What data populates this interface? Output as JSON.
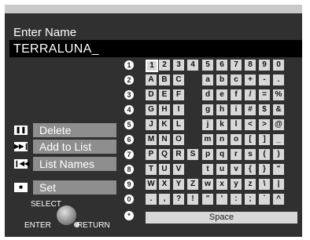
{
  "title": "Enter Name",
  "name_value": "TERRALUNA_",
  "row_numbers": [
    "1",
    "2",
    "3",
    "4",
    "5",
    "6",
    "7",
    "8",
    "9",
    "0",
    "*"
  ],
  "keys": [
    [
      "1",
      "2",
      "3",
      "4",
      "5",
      "6",
      "7",
      "8",
      "9",
      "0"
    ],
    [
      "A",
      "B",
      "C",
      "",
      "a",
      "b",
      "c",
      "+",
      "-",
      "."
    ],
    [
      "D",
      "E",
      "F",
      "",
      "d",
      "e",
      "f",
      "/",
      "=",
      "%"
    ],
    [
      "G",
      "H",
      "I",
      "",
      "g",
      "h",
      "i",
      "#",
      "$",
      "&"
    ],
    [
      "J",
      "K",
      "L",
      "",
      "j",
      "k",
      "l",
      "<",
      ">",
      "@"
    ],
    [
      "M",
      "N",
      "O",
      "",
      "m",
      "n",
      "o",
      "[",
      "]",
      "_"
    ],
    [
      "P",
      "Q",
      "R",
      "S",
      "p",
      "q",
      "r",
      "s",
      "(",
      ")"
    ],
    [
      "T",
      "U",
      "V",
      "",
      "t",
      "u",
      "v",
      "{",
      "}",
      "\""
    ],
    [
      "W",
      "X",
      "Y",
      "Z",
      "w",
      "x",
      "y",
      "z",
      "\\",
      "|"
    ],
    [
      ".",
      ",",
      "?",
      "!",
      "\"",
      "'",
      ":",
      ";",
      "`",
      "^"
    ]
  ],
  "space_label": "Space",
  "menu": {
    "delete": "Delete",
    "add_to_list": "Add to List",
    "list_names": "List Names",
    "set": "Set"
  },
  "icons": {
    "delete": "pause-icon",
    "add_to_list": "skip-next-icon",
    "list_names": "skip-previous-icon",
    "set": "stop-icon"
  },
  "legend": {
    "select": "SELECT",
    "enter": "ENTER",
    "return": "RETURN"
  },
  "colors": {
    "background": "#303030",
    "key": "#d8d8d8",
    "menu_button": "#8e8e8e"
  }
}
